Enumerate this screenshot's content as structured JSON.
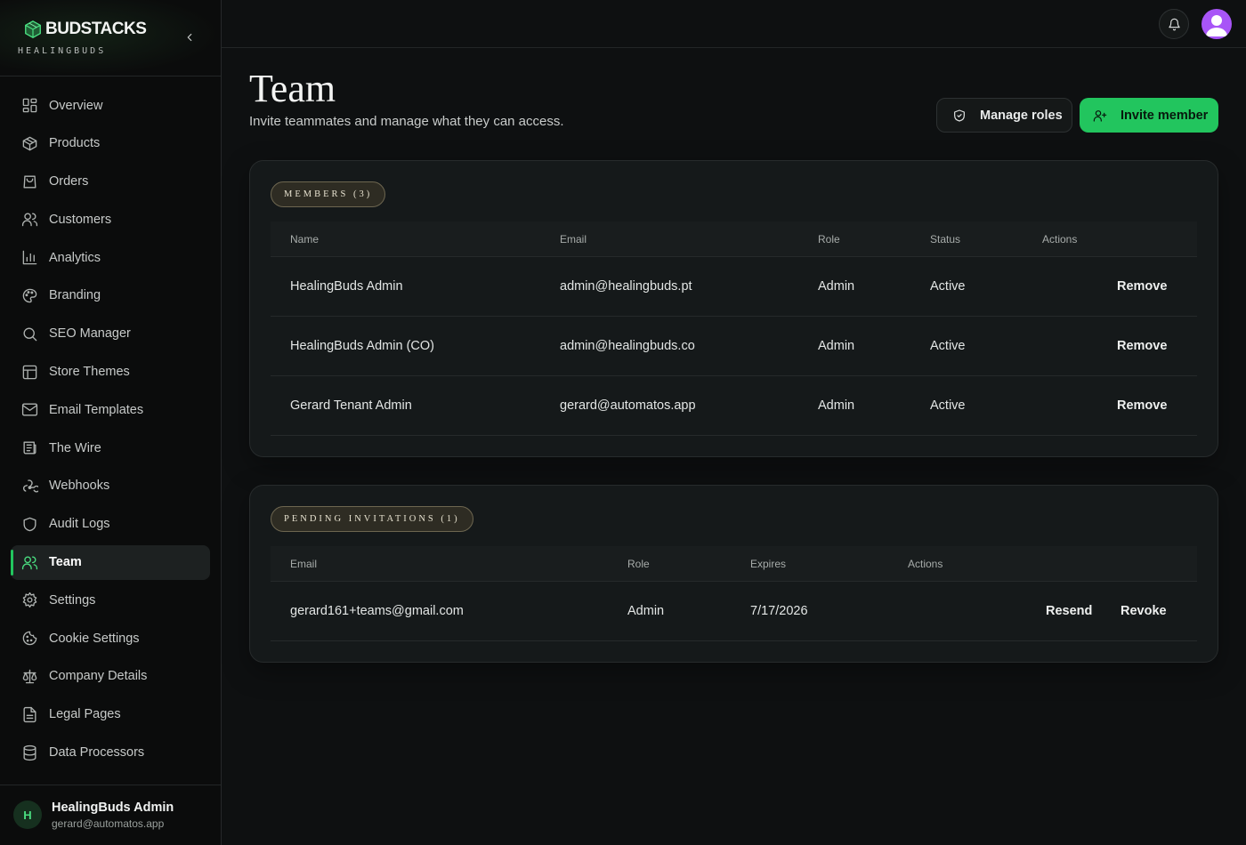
{
  "brand": {
    "name": "BUDSTACKS",
    "sub": "HEALINGBUDS"
  },
  "sidebar": {
    "items": [
      {
        "label": "Overview",
        "icon": "grid-icon",
        "active": false
      },
      {
        "label": "Products",
        "icon": "box-icon",
        "active": false
      },
      {
        "label": "Orders",
        "icon": "shopping-bag-icon",
        "active": false
      },
      {
        "label": "Customers",
        "icon": "users-icon",
        "active": false
      },
      {
        "label": "Analytics",
        "icon": "bar-chart-icon",
        "active": false
      },
      {
        "label": "Branding",
        "icon": "palette-icon",
        "active": false
      },
      {
        "label": "SEO Manager",
        "icon": "search-icon",
        "active": false
      },
      {
        "label": "Store Themes",
        "icon": "layout-icon",
        "active": false
      },
      {
        "label": "Email Templates",
        "icon": "mail-icon",
        "active": false
      },
      {
        "label": "The Wire",
        "icon": "newspaper-icon",
        "active": false
      },
      {
        "label": "Webhooks",
        "icon": "webhook-icon",
        "active": false
      },
      {
        "label": "Audit Logs",
        "icon": "shield-icon",
        "active": false
      },
      {
        "label": "Team",
        "icon": "users-icon",
        "active": true
      },
      {
        "label": "Settings",
        "icon": "gear-icon",
        "active": false
      },
      {
        "label": "Cookie Settings",
        "icon": "cookie-icon",
        "active": false
      },
      {
        "label": "Company Details",
        "icon": "scale-icon",
        "active": false
      },
      {
        "label": "Legal Pages",
        "icon": "file-text-icon",
        "active": false
      },
      {
        "label": "Data Processors",
        "icon": "database-icon",
        "active": false
      }
    ]
  },
  "user": {
    "initial": "H",
    "name": "HealingBuds Admin",
    "email": "gerard@automatos.app"
  },
  "header": {
    "title": "Team",
    "subtitle": "Invite teammates and manage what they can access."
  },
  "actions": {
    "manage_roles": "Manage roles",
    "invite_member": "Invite member"
  },
  "members": {
    "label": "MEMBERS (3)",
    "columns": [
      "Name",
      "Email",
      "Role",
      "Status",
      "Actions"
    ],
    "rows": [
      {
        "name": "HealingBuds Admin",
        "email": "admin@healingbuds.pt",
        "role": "Admin",
        "status": "Active",
        "action": "Remove"
      },
      {
        "name": "HealingBuds Admin (CO)",
        "email": "admin@healingbuds.co",
        "role": "Admin",
        "status": "Active",
        "action": "Remove"
      },
      {
        "name": "Gerard Tenant Admin",
        "email": "gerard@automatos.app",
        "role": "Admin",
        "status": "Active",
        "action": "Remove"
      }
    ]
  },
  "invitations": {
    "label": "PENDING INVITATIONS (1)",
    "columns": [
      "Email",
      "Role",
      "Expires",
      "Actions"
    ],
    "rows": [
      {
        "email": "gerard161+teams@gmail.com",
        "role": "Admin",
        "expires": "7/17/2026",
        "resend": "Resend",
        "revoke": "Revoke"
      }
    ]
  },
  "colors": {
    "accent": "#22c55e",
    "avatar": "#a855f7",
    "background": "#0e1011"
  }
}
